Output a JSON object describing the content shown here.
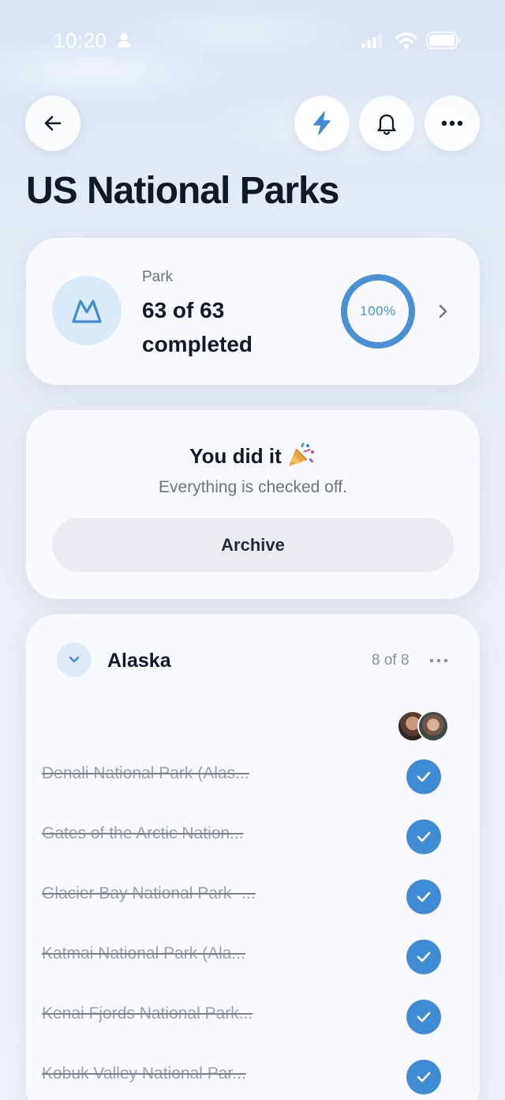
{
  "status_bar": {
    "time": "10:20"
  },
  "header": {
    "title": "US National Parks"
  },
  "progress": {
    "label": "Park",
    "count_text": "63 of 63 completed",
    "percent_text": "100%",
    "fraction": 1.0,
    "accent_color": "#4a90d9"
  },
  "completion": {
    "title": "You did it",
    "subtitle": "Everything is checked off.",
    "archive_label": "Archive"
  },
  "section": {
    "title": "Alaska",
    "count": "8 of 8",
    "items": [
      {
        "name": "Denali National Park (Alas...",
        "checked": true
      },
      {
        "name": "Gates of the Arctic Nation...",
        "checked": true
      },
      {
        "name": "Glacier Bay National Park -...",
        "checked": true
      },
      {
        "name": "Katmai National Park (Ala...",
        "checked": true
      },
      {
        "name": "Kenai Fjords National Park...",
        "checked": true
      },
      {
        "name": "Kobuk Valley National Par...",
        "checked": true
      }
    ]
  },
  "icons": {
    "back": "arrow-left-icon",
    "bolt": "lightning-bolt-icon",
    "bell": "bell-icon",
    "more": "more-horizontal-icon",
    "park": "mountain-icon",
    "chevron": "chevron-right-icon",
    "collapse": "chevron-down-icon",
    "check": "checkmark-icon"
  }
}
